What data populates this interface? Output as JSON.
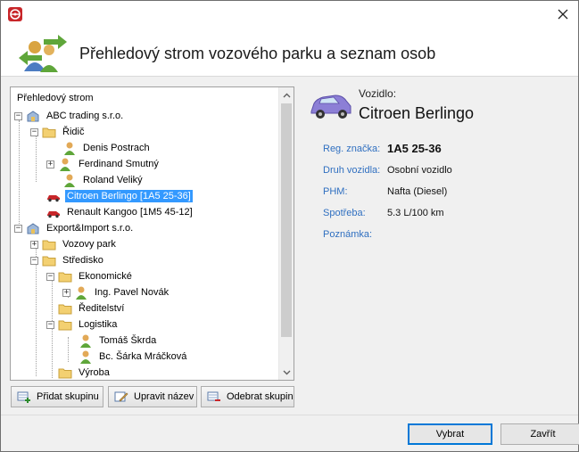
{
  "window": {
    "app_icon": "steering-wheel-icon",
    "close_glyph": "✕"
  },
  "header": {
    "title": "Přehledový strom vozového parku a seznam osob",
    "icon": "people-exchange-icon"
  },
  "tree": {
    "caption": "Přehledový strom",
    "nodes": [
      {
        "label": "ABC trading s.r.o.",
        "icon": "company-icon",
        "expander": "−"
      },
      {
        "label": "Řidič",
        "icon": "folder-icon",
        "expander": "−"
      },
      {
        "label": "Denis Postrach",
        "icon": "person-icon",
        "expander": ""
      },
      {
        "label": "Ferdinand Smutný",
        "icon": "person-icon",
        "expander": "+"
      },
      {
        "label": "Roland Veliký",
        "icon": "person-icon",
        "expander": ""
      },
      {
        "label": "Citroen Berlingo [1A5 25-36]",
        "icon": "car-icon",
        "expander": "",
        "selected": true
      },
      {
        "label": "Renault Kangoo [1M5 45-12]",
        "icon": "car-icon",
        "expander": ""
      },
      {
        "label": "Export&Import s.r.o.",
        "icon": "company-icon",
        "expander": "−"
      },
      {
        "label": "Vozovy park",
        "icon": "folder-icon",
        "expander": "+"
      },
      {
        "label": "Středisko",
        "icon": "folder-icon",
        "expander": "−"
      },
      {
        "label": "Ekonomické",
        "icon": "folder-icon",
        "expander": "−"
      },
      {
        "label": "Ing. Pavel Novák",
        "icon": "person-icon",
        "expander": "+"
      },
      {
        "label": "Ředitelství",
        "icon": "folder-icon",
        "expander": ""
      },
      {
        "label": "Logistika",
        "icon": "folder-icon",
        "expander": "−"
      },
      {
        "label": "Tomáš Škrda",
        "icon": "person-icon",
        "expander": ""
      },
      {
        "label": "Bc. Šárka Mráčková",
        "icon": "person-icon",
        "expander": ""
      },
      {
        "label": "Výroba",
        "icon": "folder-icon",
        "expander": ""
      }
    ]
  },
  "tree_buttons": {
    "add": "Přidat skupinu",
    "rename": "Upravit název",
    "remove": "Odebrat skupinu"
  },
  "detail": {
    "caption": "Vozidlo:",
    "name": "Citroen Berlingo",
    "icon": "car-large-icon",
    "props": [
      {
        "label": "Reg. značka:",
        "value": "1A5 25-36"
      },
      {
        "label": "Druh vozidla:",
        "value": "Osobní vozidlo"
      },
      {
        "label": "PHM:",
        "value": "Nafta (Diesel)"
      },
      {
        "label": "Spotřeba:",
        "value": "5.3 L/100 km"
      },
      {
        "label": "Poznámka:",
        "value": ""
      }
    ]
  },
  "footer": {
    "select": "Vybrat",
    "close": "Zavřít"
  },
  "colors": {
    "selection": "#3399ff",
    "label_blue": "#2f6fc0",
    "accent_green": "#5fa63a",
    "car_red": "#c8262a",
    "car_purple": "#8c7fd6"
  }
}
